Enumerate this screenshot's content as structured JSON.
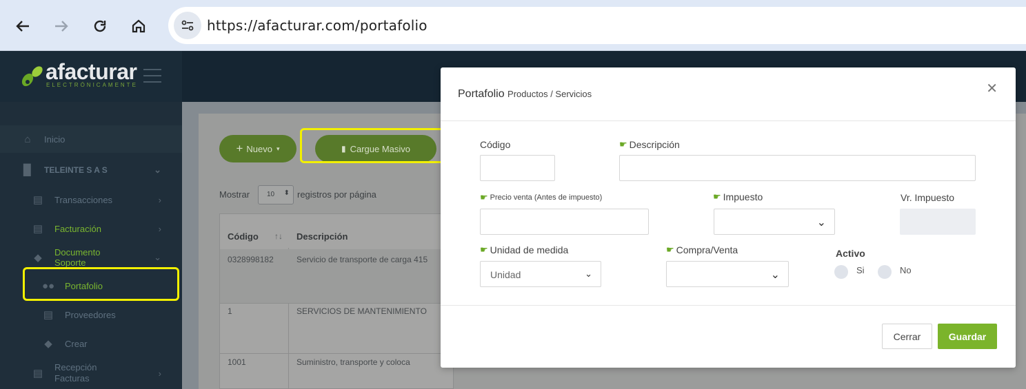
{
  "browser": {
    "url": "https://afacturar.com/portafolio",
    "back_icon": "arrow-left-icon",
    "forward_icon": "arrow-right-icon",
    "reload_icon": "reload-icon",
    "home_icon": "home-icon"
  },
  "app": {
    "logo_text": "afacturar",
    "logo_sub": "ELECTRÓNICAMENTE",
    "brand_color": "#7ab62f"
  },
  "sidebar": {
    "items": [
      {
        "label": "Inicio",
        "icon": "home-icon"
      },
      {
        "label": "TELEINTE S A S",
        "icon": "building-icon"
      },
      {
        "label": "Transacciones",
        "icon": "list-icon"
      },
      {
        "label": "Facturación",
        "icon": "invoice-icon"
      },
      {
        "label": "Documento Soporte",
        "icon": "tag-icon"
      },
      {
        "label": "Portafolio",
        "icon": "users-icon"
      },
      {
        "label": "Proveedores",
        "icon": "list-icon"
      },
      {
        "label": "Crear",
        "icon": "tags-icon"
      },
      {
        "label": "Recepción Facturas",
        "icon": "list-icon"
      }
    ]
  },
  "main": {
    "nuevo_label": "Nuevo",
    "cargue_label": "Cargue Masivo",
    "mostrar_label": "Mostrar",
    "page_size": "10",
    "registros_label": "registros por página",
    "columns": [
      "Código",
      "Descripción"
    ],
    "rows": [
      {
        "codigo": "0328998182",
        "descripcion": "Servicio de transporte de carga 415"
      },
      {
        "codigo": "1",
        "descripcion": "SERVICIOS DE MANTENIMIENTO"
      },
      {
        "codigo": "1001",
        "descripcion": "Suministro, transporte y coloca"
      }
    ]
  },
  "modal": {
    "title": "Portafolio",
    "subtitle": "Productos / Servicios",
    "close_icon": "close-icon",
    "fields": {
      "codigo_label": "Código",
      "descripcion_label": "Descripción",
      "precio_label": "Precio venta (Antes de impuesto)",
      "impuesto_label": "Impuesto",
      "vr_impuesto_label": "Vr. Impuesto",
      "unidad_label": "Unidad de medida",
      "unidad_value": "Unidad",
      "compra_venta_label": "Compra/Venta",
      "activo_label": "Activo",
      "si_label": "Si",
      "no_label": "No"
    },
    "cerrar_label": "Cerrar",
    "guardar_label": "Guardar"
  }
}
